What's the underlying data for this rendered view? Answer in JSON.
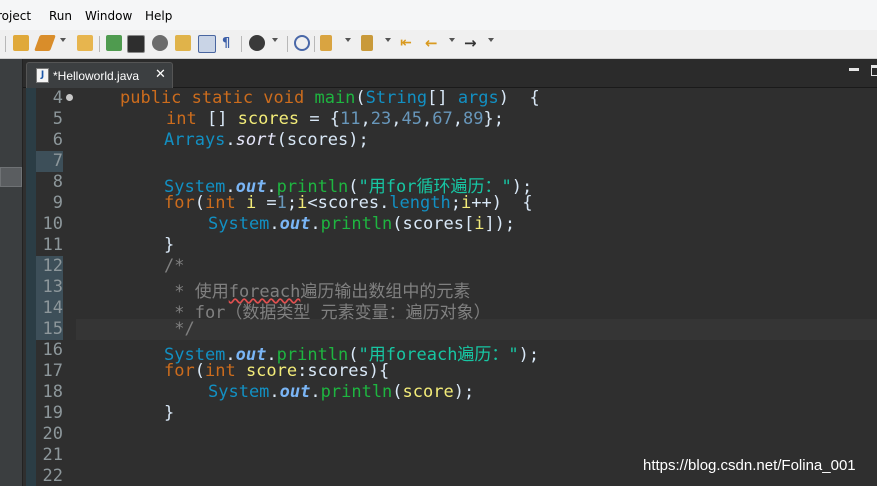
{
  "menu": [
    "roject",
    "Run",
    "Window",
    "Help"
  ],
  "toolbar": {
    "icons": [
      "open-folder-icon",
      "brush-icon",
      "folder-icon",
      "flag-icon",
      "pen-icon",
      "gear-icon",
      "refresh-icon",
      "layout-icon",
      "pilcrow-icon",
      "profile-icon",
      "circle-icon",
      "link-icon",
      "marker-icon",
      "nav-icon",
      "back-icon",
      "left-arrow-icon",
      "right-arrow-icon"
    ]
  },
  "editor_tab": {
    "label": "*Helloworld.java",
    "file_icon": "J",
    "close": "✕"
  },
  "gutter": {
    "line_numbers": [
      "4",
      "5",
      "6",
      "7",
      "8",
      "9",
      "10",
      "11",
      "12",
      "13",
      "14",
      "15",
      "16",
      "17",
      "18",
      "19",
      "20",
      "21",
      "22"
    ],
    "highlighted": [
      "7",
      "12",
      "13",
      "14",
      "15"
    ]
  },
  "code": {
    "l4": {
      "a": "public static void ",
      "b": "main",
      "c": "(",
      "d": "String",
      "e": "[] ",
      "f": "args",
      "g": ")  {"
    },
    "l5": {
      "a": "int",
      "b": " [] ",
      "c": "scores",
      "d": " = {",
      "e": "11",
      "f": ",",
      "g": "23",
      "h": ",",
      "i": "45",
      "j": ",",
      "k": "67",
      "l": ",",
      "m": "89",
      "n": "};"
    },
    "l6": {
      "a": "Arrays",
      "b": ".",
      "c": "sort",
      "d": "(scores);"
    },
    "l8": {
      "a": "System",
      "b": ".",
      "c": "out",
      "d": ".",
      "e": "println",
      "f": "(",
      "g": "\"用for循环遍历：\"",
      "h": ");"
    },
    "l9": {
      "a": "for",
      "b": "(",
      "c": "int",
      "d": " ",
      "e": "i",
      "f": " =",
      "g": "1",
      "h": ";",
      "i": "i",
      "j": "<scores.",
      "k": "length",
      "l": ";",
      "m": "i",
      "n": "++)  {"
    },
    "l10": {
      "a": "System",
      "b": ".",
      "c": "out",
      "d": ".",
      "e": "println",
      "f": "(scores[",
      "g": "i",
      "h": "]);"
    },
    "l11": {
      "a": "}"
    },
    "l12": {
      "a": "/*"
    },
    "l13": {
      "a": " * 使用",
      "b": "foreach",
      "c": "遍历输出数组中的元素"
    },
    "l14": {
      "a": " * for（数据类型 元素变量：遍历对象）"
    },
    "l15": {
      "a": " */"
    },
    "l16": {
      "a": "System",
      "b": ".",
      "c": "out",
      "d": ".",
      "e": "println",
      "f": "(",
      "g": "\"用foreach遍历：\"",
      "h": ");"
    },
    "l17": {
      "a": "for",
      "b": "(",
      "c": "int",
      "d": " ",
      "e": "score",
      "f": ":scores){"
    },
    "l18": {
      "a": "System",
      "b": ".",
      "c": "out",
      "d": ".",
      "e": "println",
      "f": "(",
      "g": "score",
      "h": ");"
    },
    "l19": {
      "a": "}"
    }
  },
  "watermark": "https://blog.csdn.net/Folina_001",
  "colors": {
    "keyword": "#cc6c1d",
    "method": "#1eb540",
    "type": "#1290c3",
    "string": "#17c6a3",
    "number": "#6897bb",
    "variable": "#f3ec79",
    "comment": "#808080",
    "editor_bg": "#2f2f2f"
  }
}
